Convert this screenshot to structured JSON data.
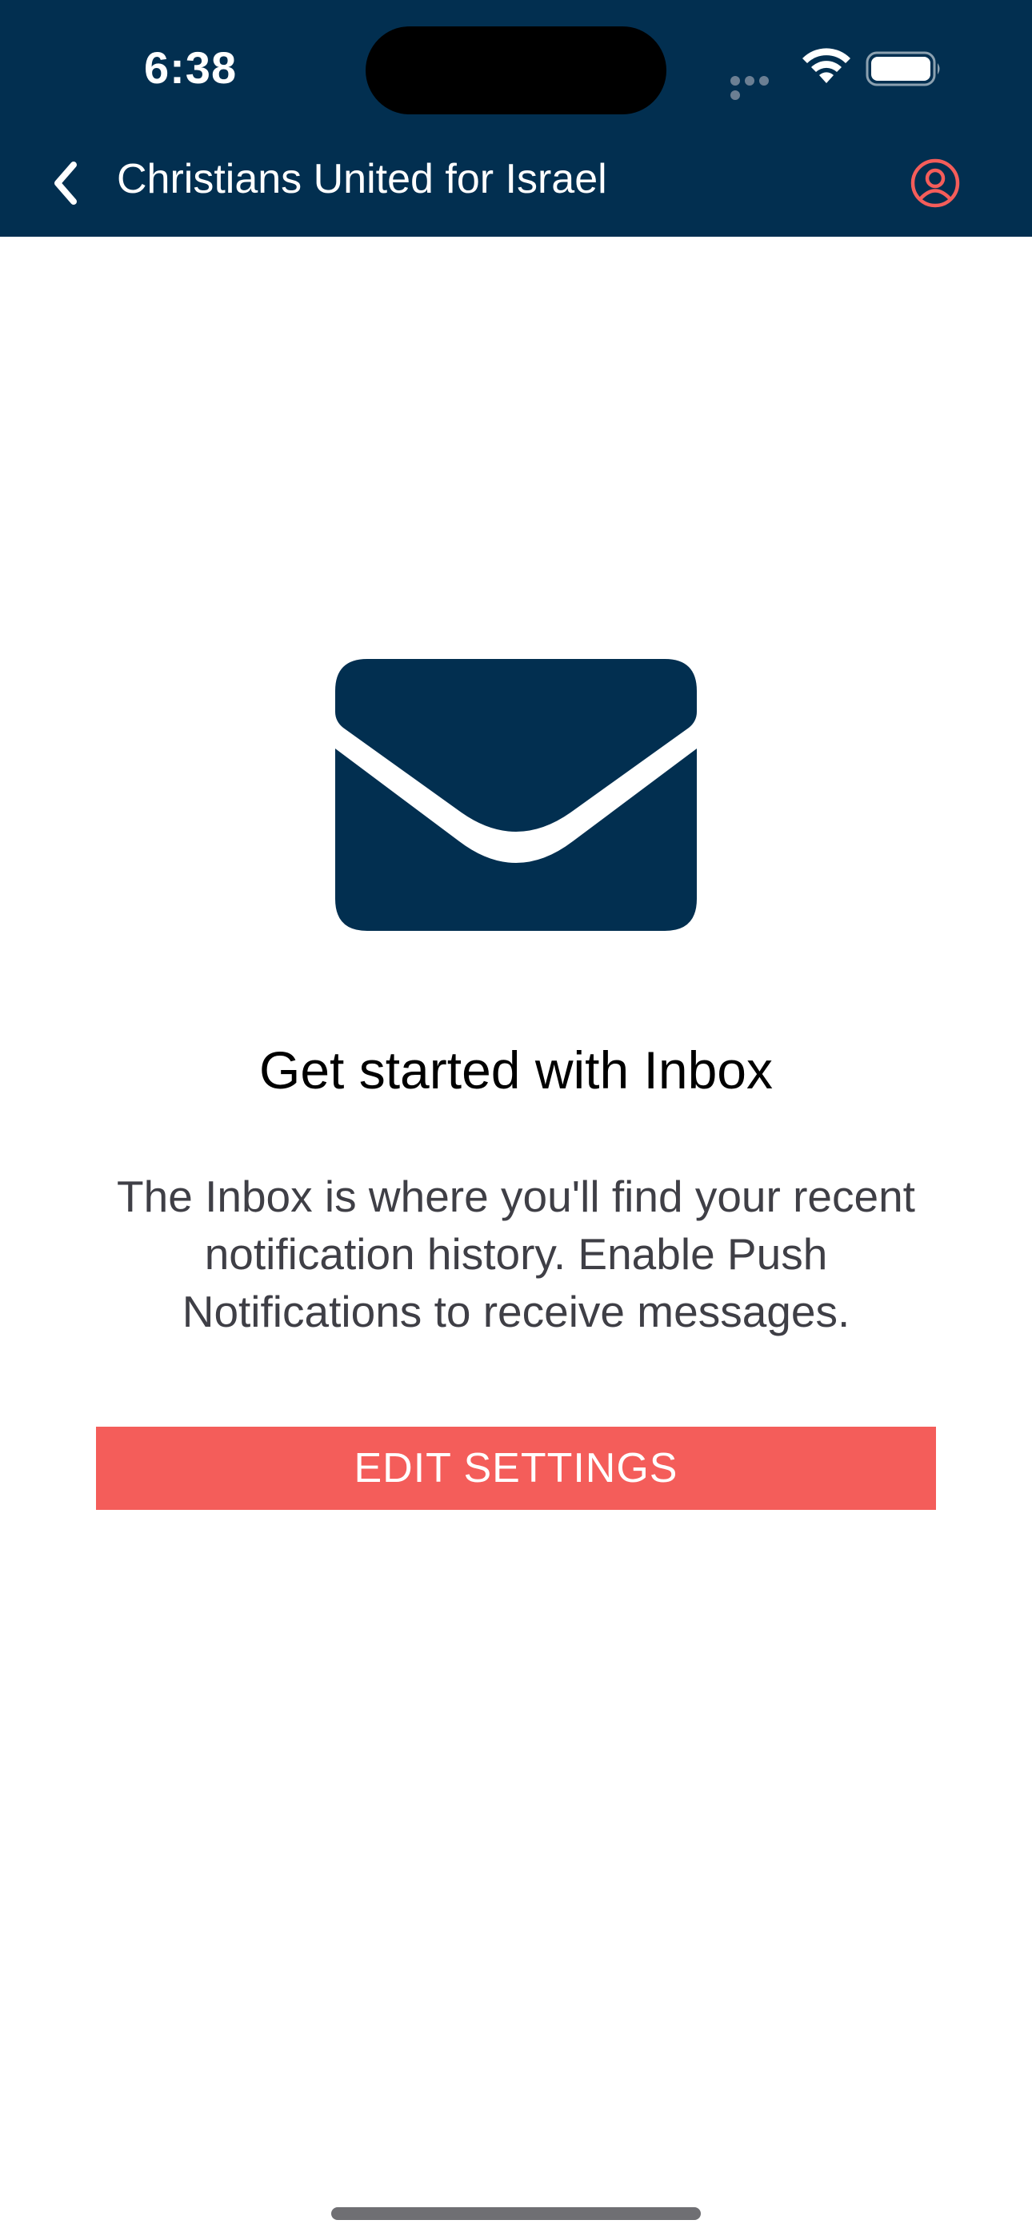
{
  "status_bar": {
    "time": "6:38",
    "signal_icon": "signal-dots-icon",
    "wifi_icon": "wifi-icon",
    "battery_icon": "battery-full-icon"
  },
  "nav": {
    "back_icon": "chevron-left-icon",
    "title": "Christians United for Israel",
    "account_icon": "user-circle-icon"
  },
  "empty_state": {
    "icon": "envelope-icon",
    "title": "Get started with Inbox",
    "body": "The Inbox is where you'll find your recent notification history. Enable Push Notifications to receive messages.",
    "button_label": "EDIT SETTINGS"
  },
  "colors": {
    "header_bg": "#022f50",
    "accent": "#f45d5a",
    "icon_navy": "#022f50",
    "body_text": "#3f3f46"
  }
}
